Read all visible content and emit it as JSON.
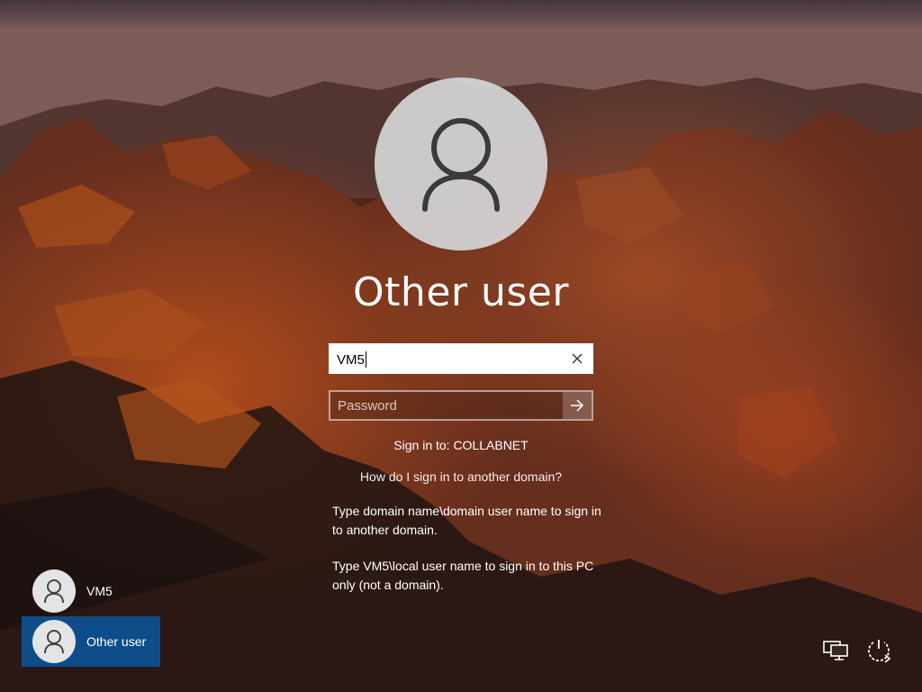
{
  "login": {
    "title": "Other user",
    "username_value": "VM5",
    "password_placeholder": "Password",
    "sign_in_to": "Sign in to: COLLABNET",
    "help_link": "How do I sign in to another domain?",
    "help_line_1": "Type domain name\\domain user name to sign in to another domain.",
    "help_line_2": "Type VM5\\local user name to sign in to this PC only (not a domain).",
    "clear_icon": "close-icon",
    "submit_icon": "arrow-right-icon"
  },
  "users": [
    {
      "label": "VM5",
      "selected": false,
      "icon": "user-icon"
    },
    {
      "label": "Other user",
      "selected": true,
      "icon": "user-icon"
    }
  ],
  "system_icons": [
    {
      "name": "network-icon"
    },
    {
      "name": "power-icon"
    }
  ],
  "colors": {
    "selected_tile": "#0f4d8a",
    "avatar_bg": "#d6d6d8"
  }
}
